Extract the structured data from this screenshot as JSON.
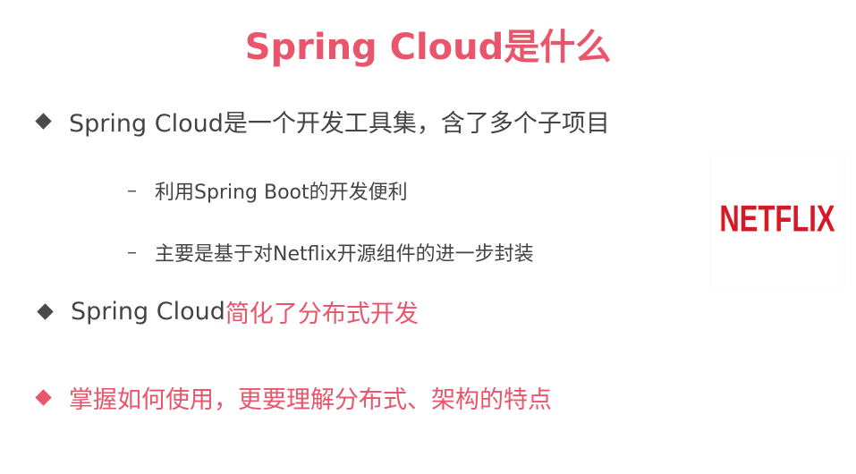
{
  "slide": {
    "title": "Spring Cloud是什么",
    "bullets": [
      {
        "text": "Spring Cloud是一个开发工具集，含了多个子项目"
      },
      {
        "text_plain": "Spring Cloud",
        "text_accent": "简化了分布式开发"
      },
      {
        "text": "掌握如何使用，更要理解分布式、架构的特点"
      }
    ],
    "sub_items": [
      {
        "dash": "–",
        "text": "利用Spring Boot的开发便利"
      },
      {
        "dash": "–",
        "text": "主要是基于对Netflix开源组件的进一步封装"
      }
    ],
    "logo": {
      "text": "NETFLIX",
      "color": "#d61a25"
    },
    "colors": {
      "accent": "#e9556b",
      "text": "#444444",
      "bullet_gray": "#4a4a4a"
    }
  }
}
